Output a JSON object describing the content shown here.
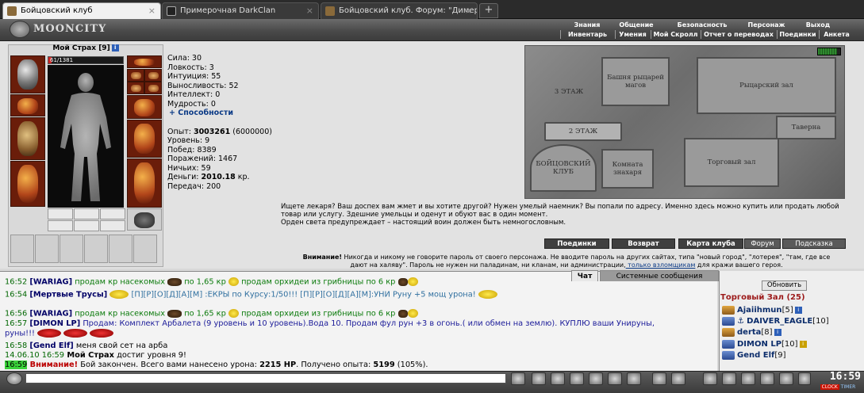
{
  "browser": {
    "tabs": [
      {
        "title": "Бойцовский клуб",
        "active": true
      },
      {
        "title": "Примерочная DarkClan",
        "active": false
      },
      {
        "title": "Бойцовский клуб. Форум: \"Димеру - ...",
        "active": false
      }
    ],
    "new_tab": "+",
    "close": "×"
  },
  "game": {
    "logo": "MOONCITY",
    "menu_top": [
      "Знания",
      "Общение",
      "Безопасность",
      "Персонаж",
      "Выход"
    ],
    "menu_sub": [
      "Инвентарь",
      "Умения",
      "Мой Скролл",
      "Отчет о переводах",
      "Поединки",
      "Анкета"
    ]
  },
  "character": {
    "name": "Мой Страх",
    "level": "[9]",
    "info_icon": "i",
    "hp_text": "61/1381",
    "hp_fraction": 0.044,
    "stats": [
      {
        "label": "Сила: ",
        "value": "30"
      },
      {
        "label": "Ловкость: ",
        "value": "3"
      },
      {
        "label": "Интуиция: ",
        "value": "55"
      },
      {
        "label": "Выносливость: ",
        "value": "52"
      },
      {
        "label": "Интеллект: ",
        "value": "0"
      },
      {
        "label": "Мудрость: ",
        "value": "0"
      }
    ],
    "abilities_link": "+ Способности",
    "exp_label": "Опыт: ",
    "exp_value": "3003261",
    "exp_next": " (6000000)",
    "level_label": "Уровень: 9",
    "wins": "Побед: 8389",
    "losses": "Поражений: 1467",
    "draws": "Ничьих: 59",
    "money_label": "Деньги: ",
    "money_value": "2010.18",
    "money_unit": " кр.",
    "transfers": "Передач: 200"
  },
  "map": {
    "rooms": [
      "3 ЭТАЖ",
      "Башня рыцарей магов",
      "Рыцарский зал",
      "2 ЭТАЖ",
      "Таверна",
      "БОЙЦОВСКИЙ КЛУБ",
      "Комната знахаря",
      "Торговый зал"
    ]
  },
  "notice": {
    "line1": "Ищете лекаря? Ваш доспех вам жмет и вы хотите другой? Нужен умелый наемник? Вы попали по адресу. Именно здесь можно купить или продать любой",
    "line2": "товар или услугу. Здешние умельцы и оденут и обуют вас в один момент.",
    "line3": "Орден света предупреждает – настоящий воин должен быть немногословным."
  },
  "nav": {
    "buttons": [
      "Поединки",
      "Возврат",
      "Карта клуба",
      "Форум",
      "Подсказка"
    ]
  },
  "warning": {
    "prefix": "Внимание!",
    "line1": " Никогда и никому не говорите пароль от своего персонажа. Не вводите пароль на других сайтах, типа \"новый город\", \"лотерея\", \"там, где все",
    "line2": "дают на халяву\". Пароль не нужен ни паладинам, ни кланам, ни администрации,",
    "line2_link": " только взломщикам",
    "line2_end": " для кражи вашего героя."
  },
  "chat": {
    "tabs": [
      "Чат",
      "Системные сообщения"
    ],
    "messages": [
      {
        "time": "16:52",
        "name": "[WARIAG]",
        "text1": " продам кр насекомых ",
        "text2": " по 1,65 кр",
        "text3": " продам орхидеи из грибницы по 6 кр "
      },
      {
        "time": "16:54",
        "name": "[Мертвые Трусы]",
        "text1": " [П][Р][О][Д][А][М] :ЕКРЫ по Курсу:1/50!!! [П][Р][О][Д][А][М]:УНИ Руну +5 мощ урона!"
      },
      {
        "time": "16:56",
        "name": "[WARIAG]",
        "text1": " продам кр насекомых ",
        "text2": " по 1,65 кр",
        "text3": " продам орхидеи из грибницы по 6 кр "
      },
      {
        "time": "16:57",
        "name": "[DIMON LP]",
        "text1": " Продам: Комплект Арбалета (9 уровень и 10 уровень).Вода 10. Продам фул рун +3 в огонь.( или обмен на землю). КУПЛЮ ваши Унируны,"
      },
      {
        "text1": "руны!!! "
      },
      {
        "time": "16:58",
        "name": "[Gend Elf]",
        "text1": " меня свой сет на арба"
      },
      {
        "time": "14.06.10 16:59",
        "name": " Мой Страх",
        "text1": " достиг уровня 9!"
      },
      {
        "time": "16:59",
        "prefix": " Внимание!",
        "text1": " Бой закончен. Всего вами нанесено урона: ",
        "dmg": "2215 HP",
        "text2": ". Получено опыта: ",
        "exp": "5199",
        "text3": " (105%)."
      }
    ]
  },
  "room": {
    "refresh_label": "Обновить",
    "title": "Торговый Зал (25)",
    "users": [
      {
        "name": "Ajaiihmun",
        "level": "[5]"
      },
      {
        "name": "DAIVER_EAGLE",
        "level": "[10]"
      },
      {
        "name": "derta",
        "level": "[8]"
      },
      {
        "name": "DIMON LP",
        "level": "[10]"
      },
      {
        "name": "Gend Elf",
        "level": "[9]"
      }
    ]
  },
  "bottom": {
    "clock": "16:59",
    "clock_label": "CLOCK",
    "timer_label": "TIMER"
  },
  "colors": {
    "accent_red": "#9c1a1a",
    "chat_time": "#006600",
    "name_blue": "#000066"
  }
}
